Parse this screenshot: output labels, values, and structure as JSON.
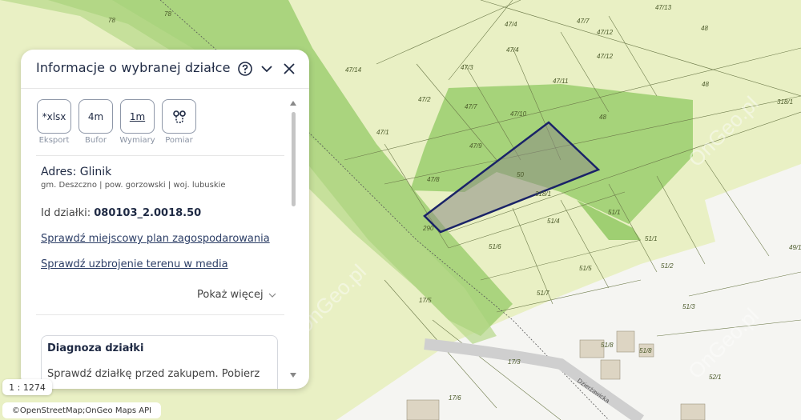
{
  "panel": {
    "title": "Informacje o wybranej działce",
    "tools": [
      {
        "icon": "*xlsx",
        "label": "Eksport"
      },
      {
        "icon": "4m",
        "label": "Bufor"
      },
      {
        "icon": "1m",
        "label": "Wymiary"
      },
      {
        "icon": "ruler-pin-icon",
        "label": "Pomiar"
      }
    ],
    "address_title": "Adres: Glinik",
    "address_sub": "gm. Deszczno | pow. gorzowski | woj. lubuskie",
    "parcel_id_label": "Id działki:",
    "parcel_id": "080103_2.0018.50",
    "link_plan": "Sprawdź miejscowy plan zagospodarowania",
    "link_media": "Sprawdź uzbrojenie terenu w media",
    "show_more": "Pokaż więcej",
    "diagnosis_title": "Diagnoza działki",
    "diagnosis_text": "Sprawdź działkę przed zakupem. Pobierz"
  },
  "map": {
    "scale": "1 : 1274",
    "attribution": "©OpenStreetMap;OnGeo Maps API",
    "watermark": "OnGeo.pl",
    "street": "Dzierżawicka",
    "parcels": [
      "78",
      "78",
      "47/4",
      "47/7",
      "47/13",
      "47/12",
      "48",
      "47/4",
      "47/12",
      "47/14",
      "47/3",
      "47/11",
      "48",
      "47/2",
      "47/7",
      "47/10",
      "318/1",
      "48",
      "47/1",
      "47/9",
      "47/8",
      "50",
      "318/1",
      "51/1",
      "51/4",
      "290",
      "51/1",
      "51/6",
      "51/5",
      "49/1",
      "51/2",
      "17/5",
      "51/7",
      "51/3",
      "51/8",
      "51/8",
      "17/3",
      "52/1",
      "17/6"
    ],
    "colors": {
      "base": "#e9f0c4",
      "zone": "#9fcf72",
      "selected": "#1a2368",
      "building": "#ddd5c3"
    }
  }
}
